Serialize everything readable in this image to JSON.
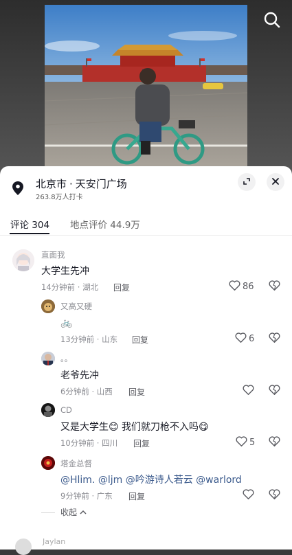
{
  "location": {
    "city": "北京市",
    "place": "天安门广场",
    "checkins": "263.8万人打卡"
  },
  "tabs": [
    {
      "label": "评论 304"
    },
    {
      "label": "地点评价 44.9万"
    }
  ],
  "comments": [
    {
      "user": "直面我",
      "text": "大学生先冲",
      "meta": "14分钟前 · 湖北",
      "reply": "回复",
      "likes": "86"
    },
    {
      "user": "又高又硬",
      "text": "🚲",
      "meta": "13分钟前 · 山东",
      "reply": "回复",
      "likes": "6"
    },
    {
      "user": "。。",
      "text": "老爷先冲",
      "meta": "6分钟前 · 山西",
      "reply": "回复",
      "likes": ""
    },
    {
      "user": "CD",
      "text": "又是大学生😊 我们就刀枪不入吗😋",
      "meta": "10分钟前 · 四川",
      "reply": "回复",
      "likes": "5"
    },
    {
      "user": "塔金总督",
      "text": "@Hlim. @ljm @吟游诗人若云 @warlord",
      "meta": "9分钟前 · 广东",
      "reply": "回复",
      "likes": ""
    }
  ],
  "collapse_label": "收起",
  "next_user": "Jaylan"
}
